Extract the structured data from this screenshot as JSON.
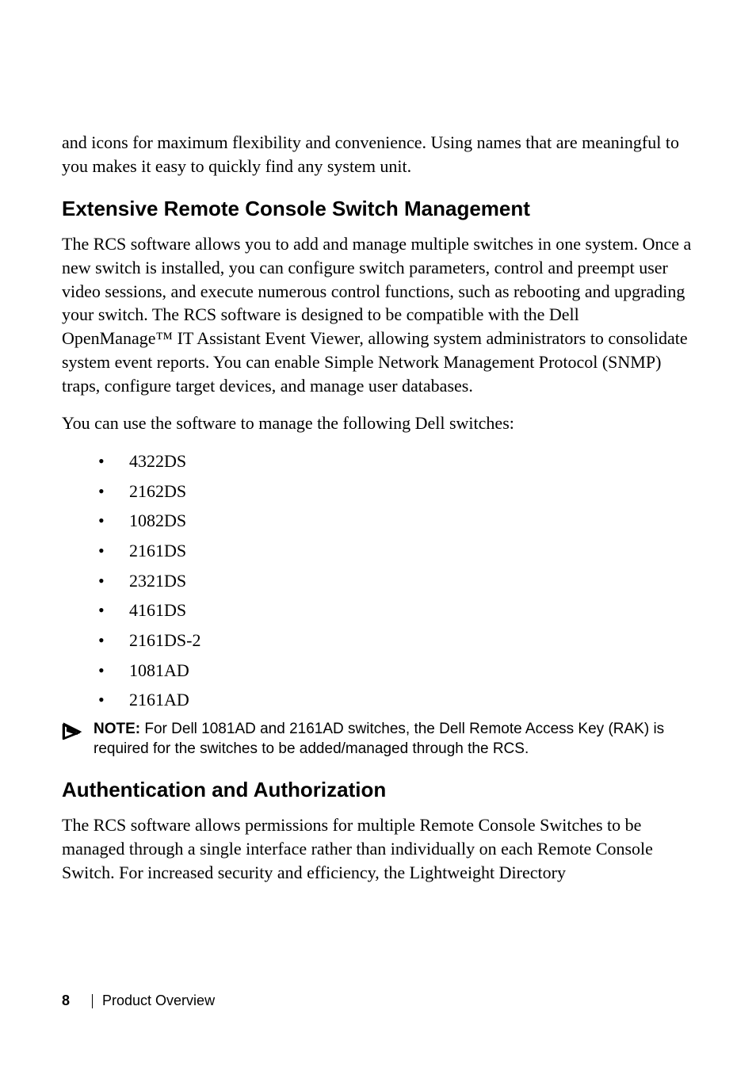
{
  "intro_text": "and icons for maximum flexibility and convenience. Using names that are meaningful to you makes it easy to quickly find any system unit.",
  "section1": {
    "heading": "Extensive Remote Console Switch Management",
    "para1": "The RCS software allows you to add and manage multiple switches in one system. Once a new switch is installed, you can configure switch parameters, control and preempt user video sessions, and execute numerous control functions, such as rebooting and upgrading your switch. The RCS software is designed to be compatible with the Dell OpenManage™ IT Assistant Event Viewer, allowing system administrators to consolidate system event reports. You can enable Simple Network Management Protocol (SNMP) traps, configure target devices, and manage user databases.",
    "para2": "You can use the software to manage the following Dell switches:",
    "bullets": [
      "4322DS",
      "2162DS",
      "1082DS",
      "2161DS",
      "2321DS",
      "4161DS",
      "2161DS-2",
      "1081AD",
      "2161AD"
    ],
    "note_label": "NOTE:",
    "note_text": " For Dell 1081AD and 2161AD switches, the Dell Remote Access Key (RAK) is required for the switches to be added/managed through the RCS."
  },
  "section2": {
    "heading": "Authentication and Authorization",
    "para1": "The RCS software allows permissions for multiple Remote Console Switches to be managed through a single interface rather than individually on each Remote Console Switch. For increased security and efficiency, the Lightweight Directory"
  },
  "footer": {
    "page_number": "8",
    "section_name": "Product Overview"
  }
}
